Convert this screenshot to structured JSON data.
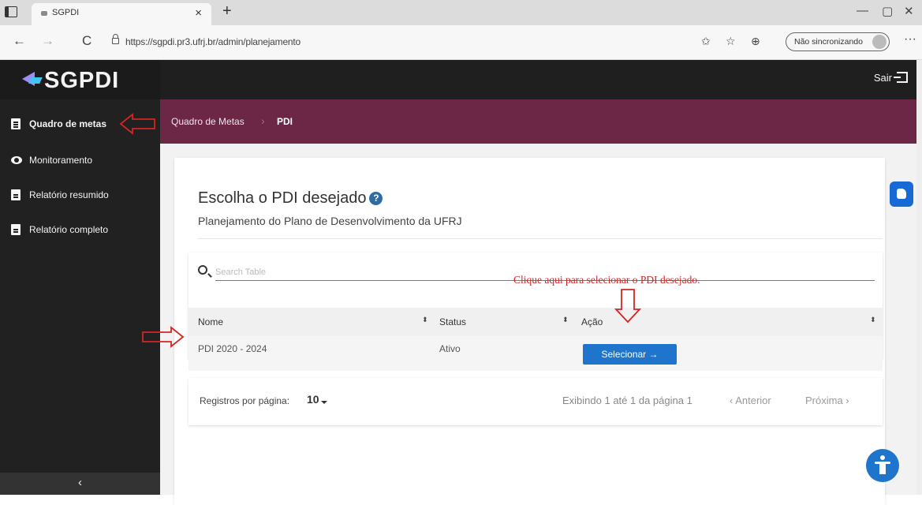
{
  "browser": {
    "tab_title": "SGPDI",
    "tab_close": "×",
    "new_tab": "+",
    "url": "https://sgpdi.pr3.ufrj.br/admin/planejamento",
    "sync_label": "Não sincronizando",
    "nav_back": "←",
    "nav_forward": "→",
    "nav_reload": "C",
    "more": "···",
    "win_min": "—",
    "win_max": "▢",
    "win_close": "✕"
  },
  "app": {
    "logo_text": "SGPDI",
    "logout_label": "Sair"
  },
  "sidebar": {
    "items": [
      {
        "label": "Quadro de metas",
        "icon": "clipboard-icon"
      },
      {
        "label": "Monitoramento",
        "icon": "eye-icon"
      },
      {
        "label": "Relatório resumido",
        "icon": "document-icon"
      },
      {
        "label": "Relatório completo",
        "icon": "document-icon"
      }
    ],
    "collapse": "‹"
  },
  "breadcrumb": {
    "items": [
      "Quadro de Metas",
      "PDI"
    ],
    "separator": "›"
  },
  "main": {
    "title": "Escolha o PDI desejado",
    "help": "?",
    "subtitle": "Planejamento do Plano de Desenvolvimento da UFRJ"
  },
  "table": {
    "search_placeholder": "Search Table",
    "columns": [
      "Nome",
      "Status",
      "Ação"
    ],
    "sort_glyph": "⬍",
    "rows": [
      {
        "nome": "PDI 2020 - 2024",
        "status": "Ativo",
        "action": "Selecionar  →"
      }
    ]
  },
  "pagination": {
    "per_page_label": "Registros por página:",
    "per_page_value": "10",
    "info": "Exibindo 1 até 1 da página 1",
    "prev": "‹ Anterior",
    "next": "Próxima ›"
  },
  "annotation": {
    "text": "Clique aqui para selecionar o PDI desejado.",
    "color": "#d42525"
  },
  "colors": {
    "sidebar_bg": "#212121",
    "breadcrumb_bg": "#6c2646",
    "primary_button": "#1f75cc"
  }
}
